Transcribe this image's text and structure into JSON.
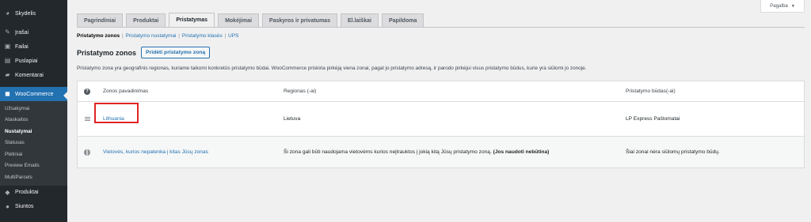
{
  "sidebar": {
    "items_top": [
      {
        "label": "Skydelis",
        "icon": "dashboard-icon"
      },
      {
        "label": "Įrašai",
        "icon": "pin-icon"
      },
      {
        "label": "Failai",
        "icon": "media-icon"
      },
      {
        "label": "Puslapiai",
        "icon": "pages-icon"
      },
      {
        "label": "Komentarai",
        "icon": "comments-icon"
      }
    ],
    "woocommerce": {
      "label": "WooCommerce",
      "icon": "woocommerce-icon"
    },
    "submenu": [
      "Užsakymai",
      "Ataskaitos",
      "Nustatymai",
      "Statusas",
      "Plėtiniai",
      "Preview Emails",
      "MultiParcels"
    ],
    "current_sub": "Nustatymai",
    "items_bottom": [
      {
        "label": "Produktai",
        "icon": "products-icon"
      },
      {
        "label": "Siuntos",
        "icon": "shipments-icon"
      }
    ]
  },
  "help": {
    "label": "Pagalba"
  },
  "tabs": [
    "Pagrindiniai",
    "Produktai",
    "Pristatymas",
    "Mokėjimai",
    "Paskyros ir privatumas",
    "El.laiškai",
    "Papildoma"
  ],
  "active_tab": "Pristatymas",
  "subsub": {
    "current": "Pristatymo zonos",
    "links": [
      "Pristatymo nustatymai",
      "Pristatymo klasės",
      "UPS"
    ]
  },
  "heading": {
    "title": "Pristatymo zonos",
    "add_button": "Pridėti pristatymo zoną"
  },
  "description": "Pristatymo zona yra geografinis regionas, kuriame taikomi konkretūs pristatymo būdai. WooCommerce priskiria pirkėją viena zonai, pagal jo pristatymo adresą, ir parodo pirkėjui visus pristatymo būdus, kurie yra siūlomi jo zonoje.",
  "table": {
    "headers": {
      "name": "Zonos pavadinimas",
      "region": "Regionas (-ai)",
      "methods": "Pristatymo būdas(-ai)"
    },
    "rows": [
      {
        "name": "Lithuania",
        "region": "Lietuva",
        "methods": "LP Express Paštomatai"
      }
    ],
    "rest": {
      "name": "Vietovės, kurios nepatenka į kitas Jūsų zonas",
      "region_text": "Ši zona gali būti naudojama vietovėms kurios neįtrauktos į jokią kitą Jūsų pristatymo zoną.",
      "region_bold": "(Jos naudoti nebūtina)",
      "methods": "Šiai zonai nėra siūlomų pristatymo būdų."
    }
  },
  "colors": {
    "accent": "#2271b1",
    "sidebar": "#23282d",
    "highlight": "#e02424"
  }
}
